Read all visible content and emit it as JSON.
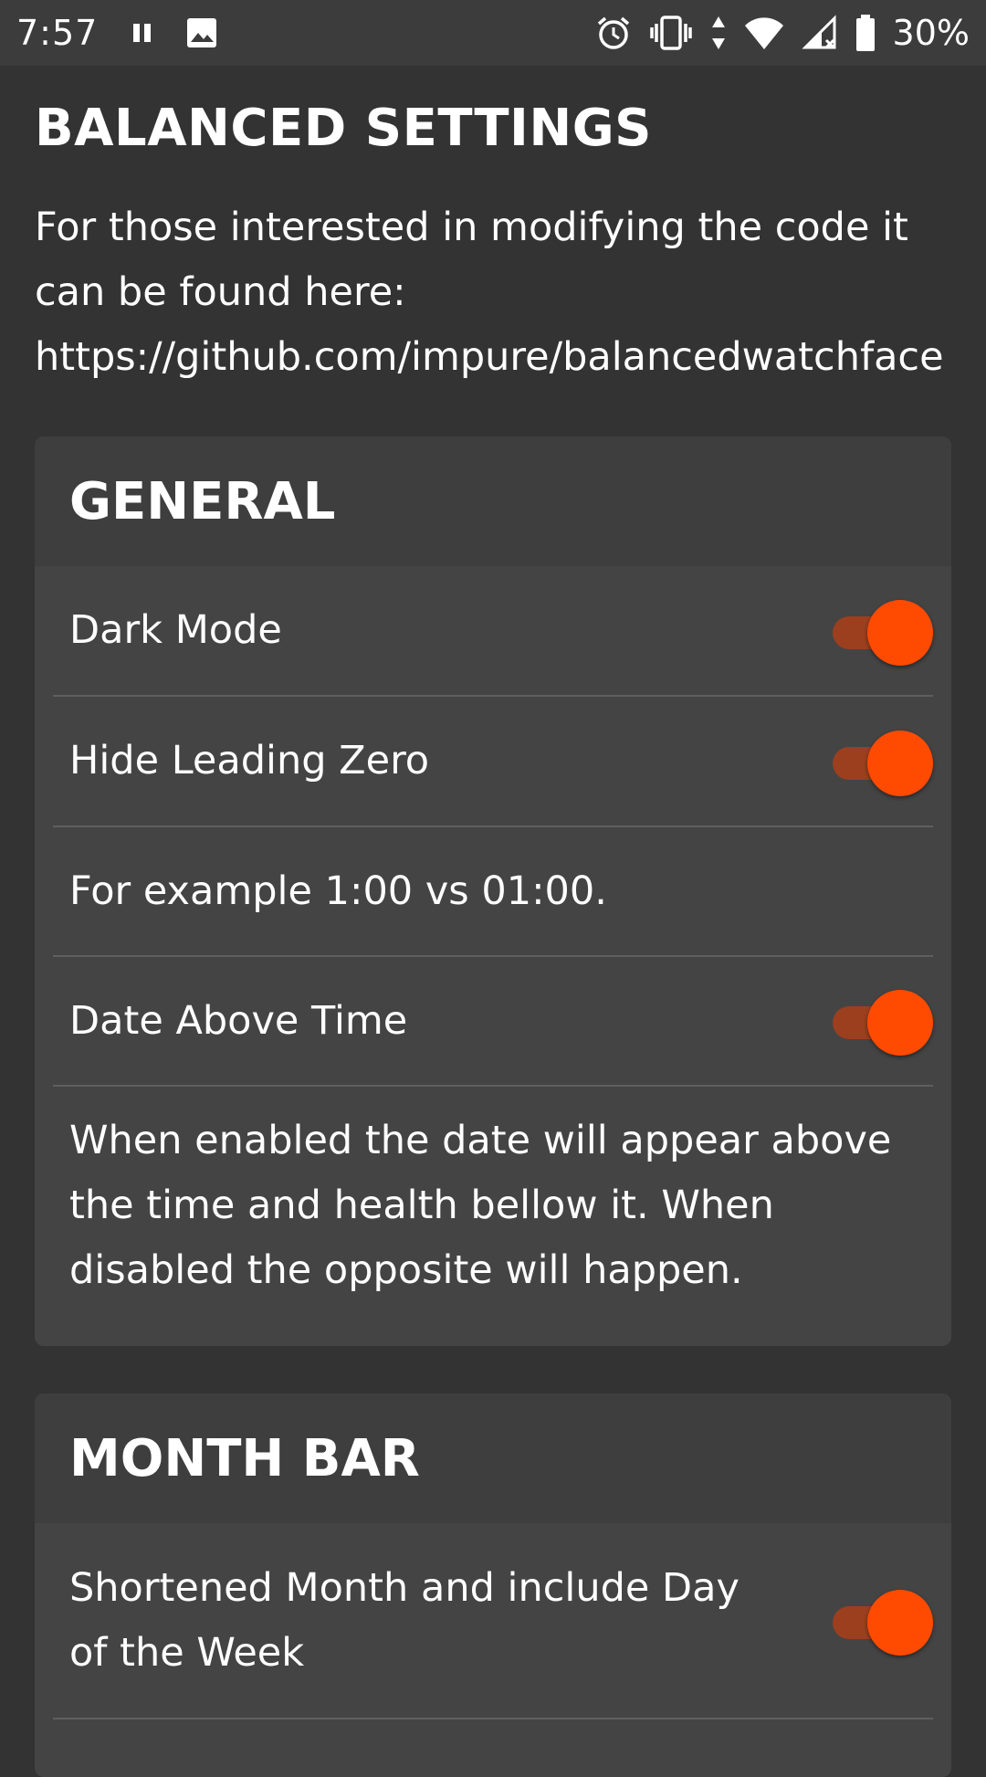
{
  "status_bar": {
    "time": "7:57",
    "battery": "30%",
    "icons": [
      "pause-icon",
      "image-icon",
      "alarm-icon",
      "vibrate-icon",
      "data-arrows-icon",
      "wifi-icon",
      "cell-signal-icon",
      "battery-icon"
    ]
  },
  "header": {
    "title": "BALANCED SETTINGS",
    "desc_lines": [
      "For those interested in modifying the code it",
      "can be found here:",
      "https://github.com/impure/balancedwatchface"
    ]
  },
  "general": {
    "title": "GENERAL",
    "dark_mode": {
      "label": "Dark Mode",
      "enabled": true
    },
    "hide_leading_zero": {
      "label": "Hide Leading Zero",
      "enabled": true
    },
    "hide_leading_zero_desc": "For example 1:00 vs 01:00.",
    "date_above_time": {
      "label": "Date Above Time",
      "enabled": true
    },
    "date_above_time_desc": [
      "When enabled the date will appear above",
      "the time and health bellow it. When",
      "disabled the opposite will happen."
    ]
  },
  "month_bar": {
    "title": "MONTH BAR",
    "shortened_month": {
      "label_lines": [
        "Shortened Month and include Day",
        "of the Week"
      ],
      "enabled": true
    }
  },
  "colors": {
    "accent": "#ff4a02",
    "track": "#9b3f1f",
    "background": "#333333",
    "card": "#444444"
  }
}
